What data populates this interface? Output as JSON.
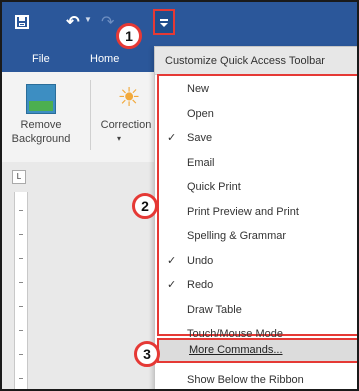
{
  "tabs": {
    "file": "File",
    "home": "Home"
  },
  "ribbon": {
    "remove_background": "Remove\nBackground",
    "corrections": "Correction",
    "corrections_arrow": "▾"
  },
  "ruler_corner": "L",
  "menu": {
    "header": "Customize Quick Access Toolbar",
    "items": [
      {
        "label": "New",
        "checked": false
      },
      {
        "label": "Open",
        "checked": false
      },
      {
        "label": "Save",
        "checked": true
      },
      {
        "label": "Email",
        "checked": false
      },
      {
        "label": "Quick Print",
        "checked": false
      },
      {
        "label": "Print Preview and Print",
        "checked": false
      },
      {
        "label": "Spelling & Grammar",
        "checked": false
      },
      {
        "label": "Undo",
        "checked": true
      },
      {
        "label": "Redo",
        "checked": true
      },
      {
        "label": "Draw Table",
        "checked": false
      },
      {
        "label": "Touch/Mouse Mode",
        "checked": false
      }
    ],
    "more_commands": "More Commands...",
    "show_below": "Show Below the Ribbon",
    "check_glyph": "✓"
  },
  "callouts": {
    "one": "1",
    "two": "2",
    "three": "3"
  },
  "colors": {
    "accent": "#2b579a",
    "highlight": "#e53935"
  }
}
